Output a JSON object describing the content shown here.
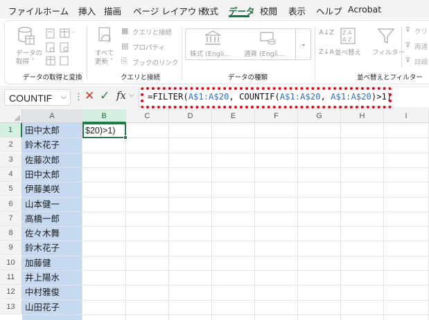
{
  "menu": {
    "tabs": [
      "ファイル",
      "ホーム",
      "挿入",
      "描画",
      "ページ レイアウト",
      "数式",
      "データ",
      "校閲",
      "表示",
      "ヘルプ",
      "Acrobat"
    ],
    "active_tab": "データ"
  },
  "ribbon": {
    "get_data": {
      "label": "データの\n取得",
      "line1": "データの",
      "line2": "取得 ˅"
    },
    "refresh_all": {
      "line1": "すべて",
      "line2": "更新 ˅"
    },
    "queries_connections": "クエリと接続",
    "properties": "プロパティ",
    "edit_links": "ブックのリンク",
    "stocks": "株式 (Engli…",
    "currencies": "通貨 (Engli…",
    "sort_az": "A↓Z",
    "sort": "並べ替え",
    "filter": "フィルター",
    "clear": "クリ",
    "reapply": "再通",
    "advanced": "詳細",
    "groups": {
      "get_transform": "データの取得と変換",
      "queries": "クエリと接続",
      "data_types": "データの種類",
      "sort_filter": "並べ替えとフィルター"
    }
  },
  "formula_bar": {
    "name_box": "COUNTIF",
    "fx": "fx",
    "formula_parts": [
      {
        "text": "=FILTER(",
        "ref": false
      },
      {
        "text": "A$1:A$20",
        "ref": true
      },
      {
        "text": ", COUNTIF(",
        "ref": false
      },
      {
        "text": "A$1:A$20",
        "ref": true
      },
      {
        "text": ", ",
        "ref": false
      },
      {
        "text": "A$1:A$20",
        "ref": true
      },
      {
        "text": ")>1)",
        "ref": false
      }
    ]
  },
  "grid": {
    "columns": [
      "A",
      "B",
      "C",
      "D",
      "E",
      "F",
      "G",
      "H",
      "I"
    ],
    "active_column": "B",
    "active_row": "1",
    "rows": [
      "1",
      "2",
      "3",
      "4",
      "5",
      "6",
      "7",
      "8",
      "9",
      "10",
      "11",
      "12",
      "13"
    ],
    "column_a": [
      "田中太郎",
      "鈴木花子",
      "佐藤次郎",
      "田中太郎",
      "伊藤美咲",
      "山本健一",
      "高橋一郎",
      "佐々木舞",
      "鈴木花子",
      "加藤健",
      "井上陽水",
      "中村雅俊",
      "山田花子"
    ],
    "cell_b1": "$20)>1)"
  }
}
